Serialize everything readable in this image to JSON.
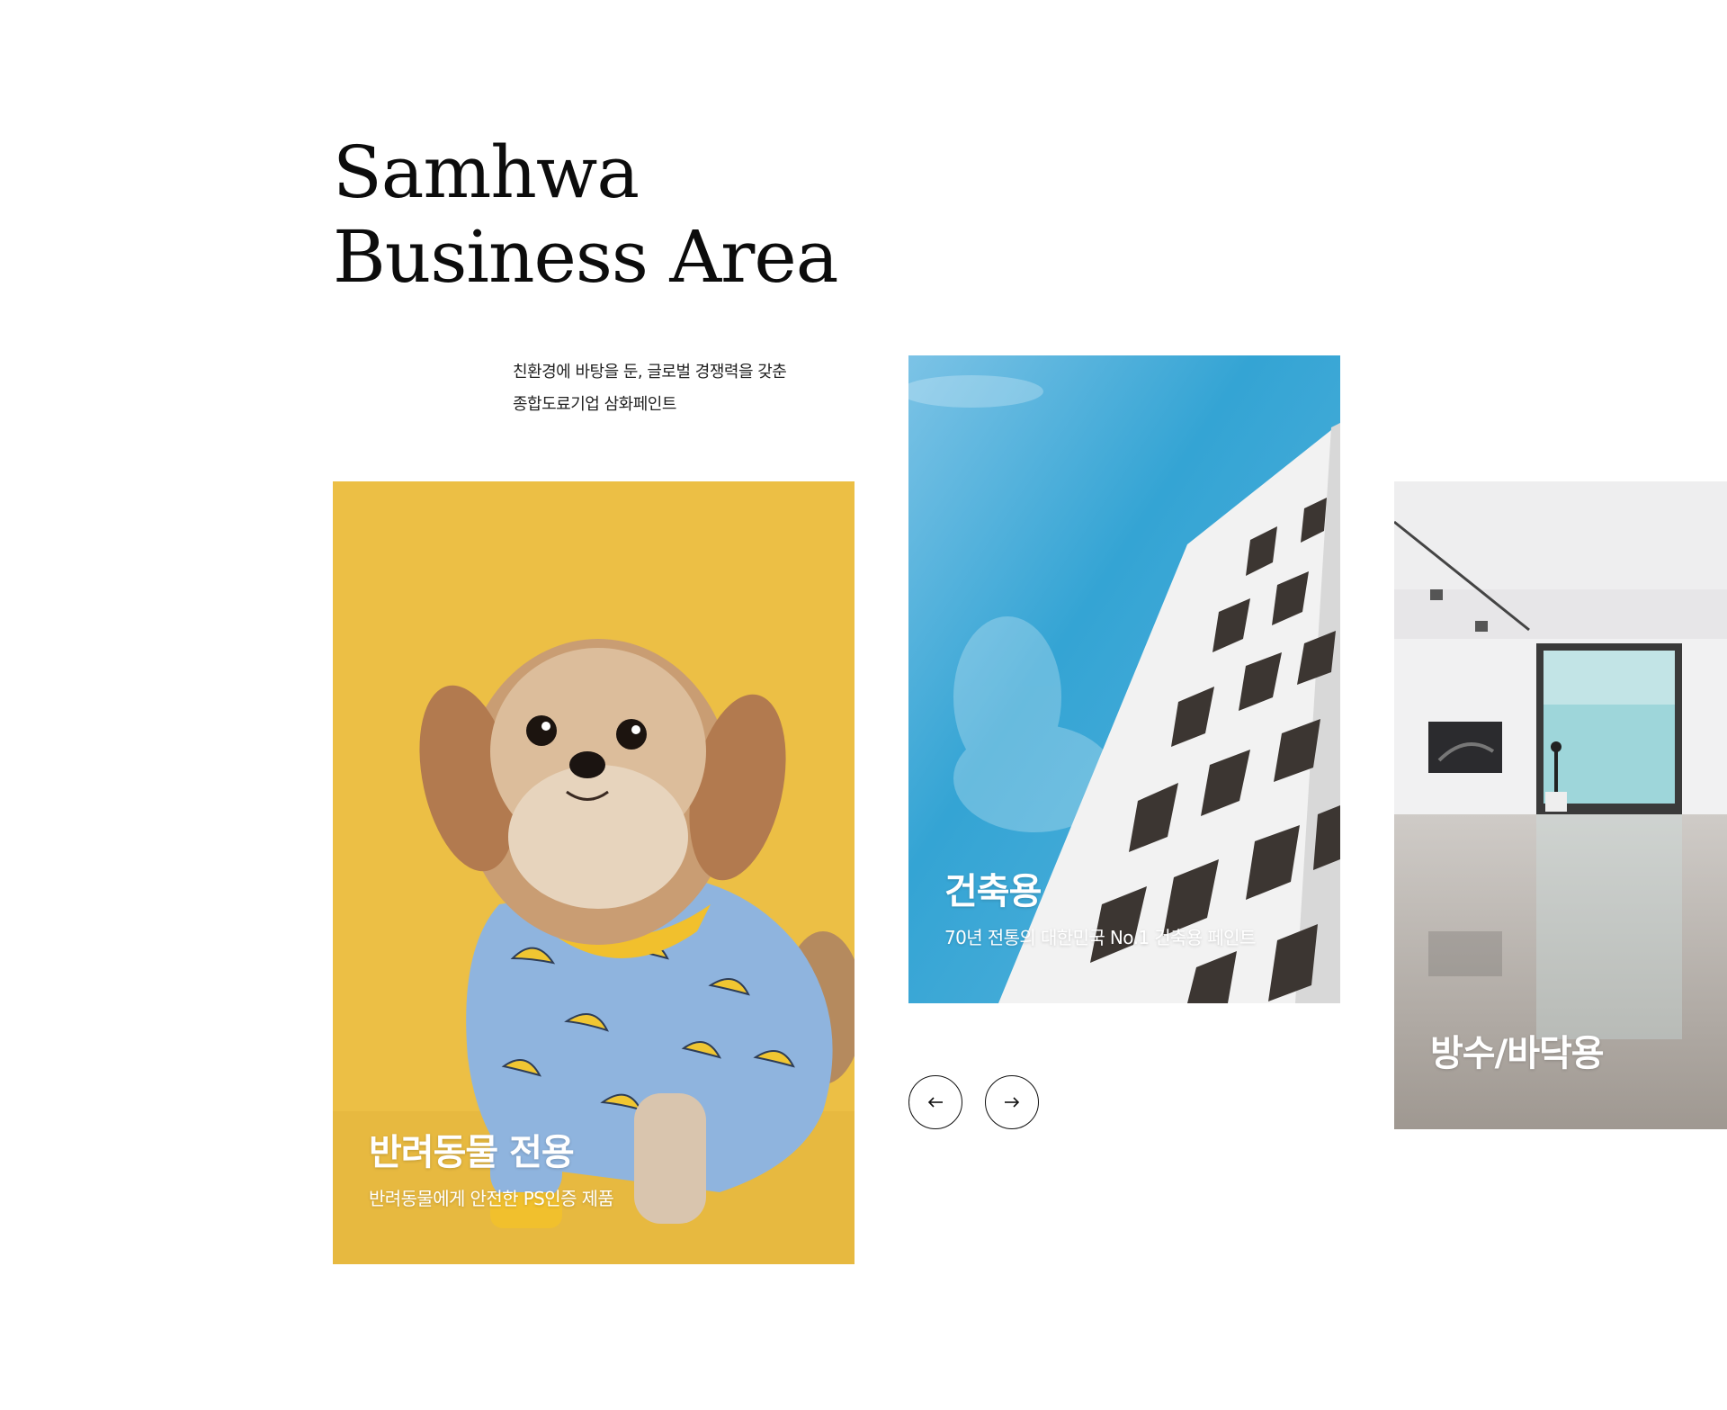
{
  "section": {
    "title_line1": "Samhwa",
    "title_line2": "Business Area",
    "intro_line1": "친환경에 바탕을 둔, 글로벌 경쟁력을 갖춘",
    "intro_line2": "종합도료기업 삼화페인트"
  },
  "cards": [
    {
      "title": "반려동물 전용",
      "subtitle": "반려동물에게 안전한 PS인증 제품",
      "background": "#ecbf45"
    },
    {
      "title": "건축용",
      "subtitle": "70년 전통의 대한민국 No.1 건축용 페인트",
      "background": "#34a4d4"
    },
    {
      "title": "방수/바닥용",
      "subtitle": "",
      "background": "#dcdbdd"
    }
  ],
  "controls": {
    "prev_icon": "arrow-left-icon",
    "next_icon": "arrow-right-icon"
  }
}
